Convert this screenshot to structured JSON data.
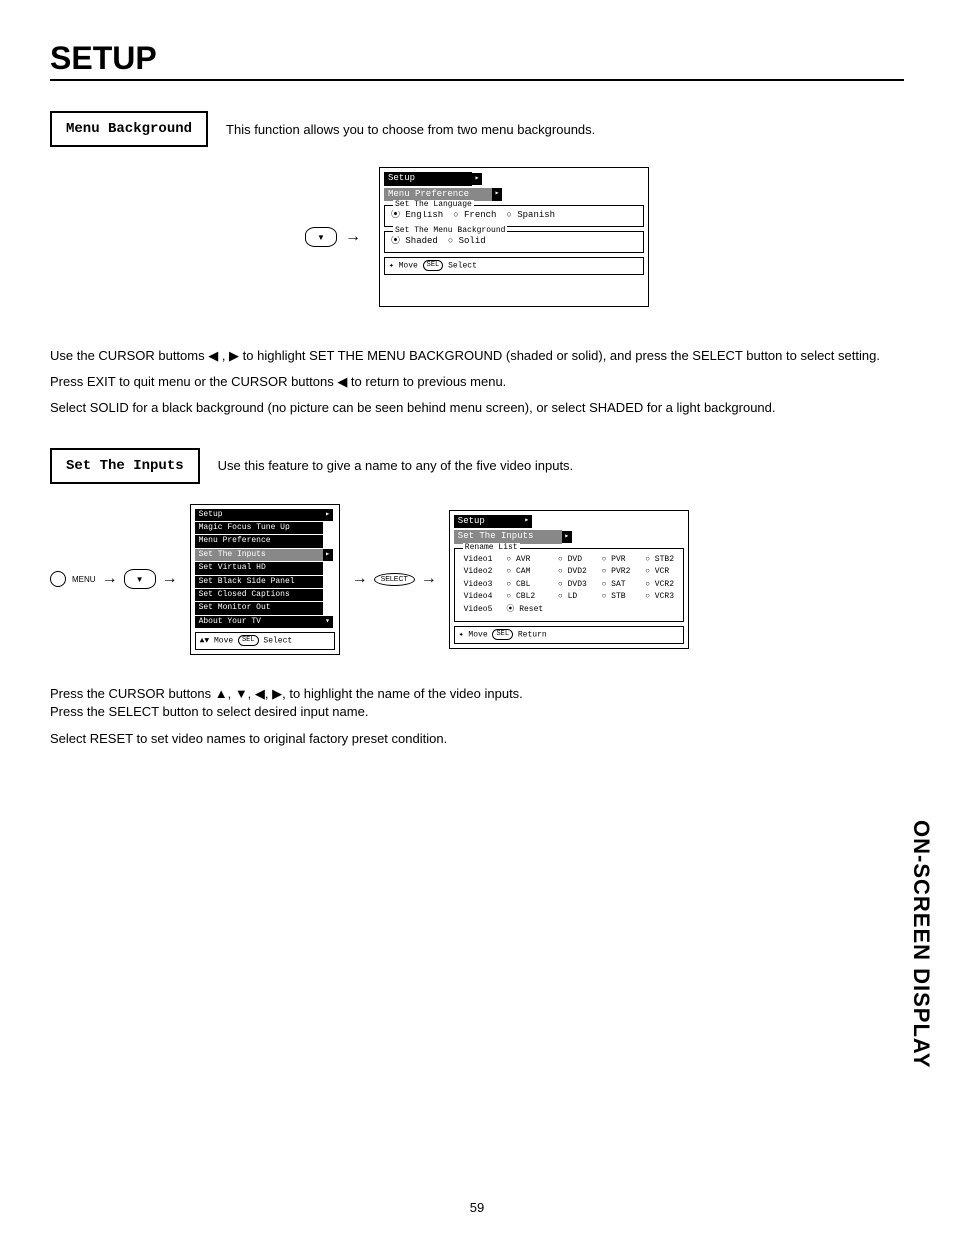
{
  "page": {
    "title": "SETUP",
    "number": "59",
    "side_tab": "ON-SCREEN DISPLAY"
  },
  "section1": {
    "label": "Menu Background",
    "desc": "This function allows you to choose from two menu backgrounds.",
    "osd": {
      "title": "Setup",
      "sub": "Menu Preference",
      "lang_label": "Set The Language",
      "lang_opts": {
        "a": "⦿ English",
        "b": "○ French",
        "c": "○ Spanish"
      },
      "bg_label": "Set The Menu Background",
      "bg_opts": {
        "a": "⦿ Shaded",
        "b": "○ Solid"
      },
      "hint_move": "✦ Move",
      "hint_sel": "Select",
      "sel_pill": "SEL"
    },
    "body1": "Use the CURSOR buttoms ◀ , ▶ to highlight SET THE MENU BACKGROUND (shaded or solid), and press the SELECT button to select setting.",
    "body2": "Press EXIT to quit menu or the CURSOR buttons ◀ to return to previous menu.",
    "body3": "Select SOLID for a black background (no picture can be seen behind menu screen), or select SHADED for a light background."
  },
  "section2": {
    "label": "Set The Inputs",
    "desc": "Use this feature to give a name to any of the five video inputs.",
    "remote": {
      "menu": "MENU",
      "select": "SELECT"
    },
    "menu_list": {
      "title": "Setup",
      "items": {
        "i1": "Magic Focus Tune Up",
        "i2": "Menu Preference",
        "i3": "Set The Inputs",
        "i4": "Set Virtual HD",
        "i5": "Set Black Side Panel",
        "i6": "Set Closed Captions",
        "i7": "Set Monitor Out",
        "i8": "About Your TV"
      },
      "hint_move": "▲▼ Move",
      "hint_sel": "Select",
      "sel_pill": "SEL"
    },
    "rename": {
      "title": "Setup",
      "sub": "Set The Inputs",
      "fieldset": "Rename List",
      "rows": {
        "v1": "Video1",
        "v2": "Video2",
        "v3": "Video3",
        "v4": "Video4",
        "v5": "Video5"
      },
      "opts": {
        "r1": {
          "a": "○ AVR",
          "b": "○ DVD",
          "c": "○ PVR",
          "d": "○ STB2"
        },
        "r2": {
          "a": "○ CAM",
          "b": "○ DVD2",
          "c": "○ PVR2",
          "d": "○ VCR"
        },
        "r3": {
          "a": "○ CBL",
          "b": "○ DVD3",
          "c": "○ SAT",
          "d": "○ VCR2"
        },
        "r4": {
          "a": "○ CBL2",
          "b": "○ LD",
          "c": "○ STB",
          "d": "○ VCR3"
        },
        "r5": {
          "a": "⦿ Reset",
          "b": "",
          "c": "",
          "d": ""
        }
      },
      "hint_move": "✦ Move",
      "hint_ret": "Return",
      "sel_pill": "SEL"
    },
    "body1": "Press the CURSOR buttons ▲, ▼, ◀, ▶, to highlight the name of the video inputs.",
    "body2": "Press the SELECT button to select desired input name.",
    "body3": "Select RESET to set video names to original factory preset condition."
  }
}
